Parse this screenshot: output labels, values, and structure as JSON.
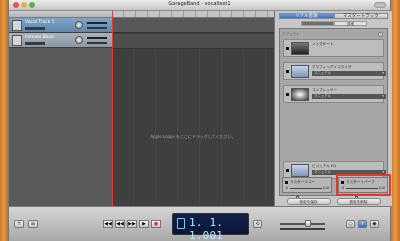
{
  "window": {
    "title": "GarageBand - vocaltest1"
  },
  "tracks": [
    {
      "name": "Vocal Track 1",
      "selected": true
    },
    {
      "name": "Female Basic",
      "selected": false
    }
  ],
  "arrange": {
    "ruler_label": "",
    "drop_hint": "Apple Loops をここにドラッグしてください。"
  },
  "inspector": {
    "tabs": [
      {
        "label": "リアル音源",
        "active": true
      },
      {
        "label": "マスタートラック",
        "active": false
      }
    ],
    "subtabs": [
      {
        "label": "",
        "active": true
      },
      {
        "label": "詳細",
        "active": false
      }
    ],
    "section_label": "エフェクト",
    "effects": [
      {
        "name": "ノイズゲート",
        "preset": ""
      },
      {
        "name": "グラフィックイコライザ",
        "preset": "マニュアル"
      },
      {
        "name": "コンプレッサー",
        "preset": "マニュアル"
      },
      {
        "name": "ビジュアル EQ",
        "preset": "マニュアル"
      }
    ],
    "master_echo": {
      "label": "マスターエコー",
      "min": "0",
      "max": "100",
      "level": 0.25
    },
    "master_reverb": {
      "label": "マスターリバーブ",
      "min": "0",
      "max": "100",
      "level": 0.35
    },
    "buttons": {
      "save": "設定を保存",
      "delete": "設定を削除"
    }
  },
  "transport": {
    "display_time": "1. 1. 1.001",
    "display_sub": "",
    "master_volume": 0.6
  },
  "colors": {
    "accent": "#2f6fc4",
    "highlight": "#e2392d",
    "playhead": "#e23b2f",
    "lcd_bg": "#0a1636"
  }
}
